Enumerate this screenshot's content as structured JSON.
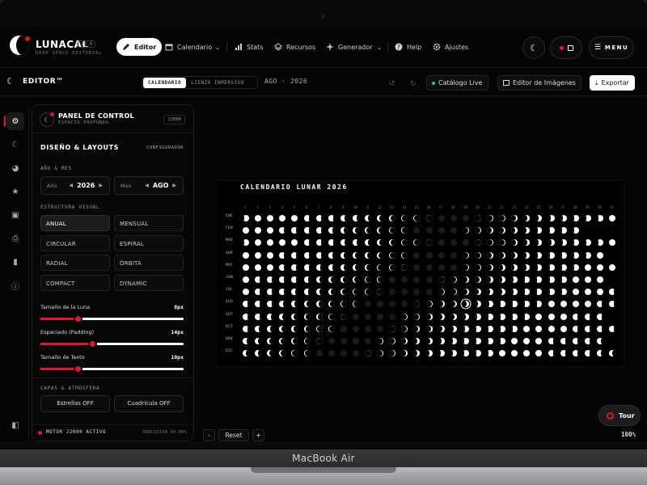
{
  "device": {
    "label": "MacBook Air"
  },
  "app": {
    "name": "LUNACAL",
    "version": "v2.6",
    "tagline": "DEEP SPACE EDITORIAL"
  },
  "nav": {
    "items": [
      {
        "label": "Editor",
        "icon": "pen-icon",
        "active": true
      },
      {
        "label": "Calendario",
        "icon": "calendar-icon",
        "active": false
      },
      {
        "label": "Stats",
        "icon": "bar-chart-icon",
        "active": false
      },
      {
        "label": "Recursos",
        "icon": "layers-icon",
        "active": false
      },
      {
        "label": "Generador",
        "icon": "sparkle-icon",
        "active": false
      },
      {
        "label": "Help",
        "icon": "help-icon",
        "active": false
      },
      {
        "label": "Ajustes",
        "icon": "gear-icon",
        "active": false
      }
    ],
    "menu_label": "MENU"
  },
  "toolbar": {
    "title": "EDITOR™",
    "views": [
      {
        "label": "CALENDARIO",
        "active": true
      },
      {
        "label": "LIENZO INMERSIVO",
        "active": false
      }
    ],
    "month": "AGO · 2026",
    "catalog_label": "Catálogo Live",
    "image_editor_label": "Editor de Imágenes",
    "export_label": "Exportar"
  },
  "panel": {
    "title": "PANEL DE CONTROL",
    "subtitle": "ESPACIO PROFUNDO",
    "tag": "J2000",
    "section_title": "DISEÑO & LAYOUTS",
    "section_link": "CONFIGURADOR",
    "year_month_label": "AÑO & MES",
    "year": {
      "label": "Año",
      "value": "2026"
    },
    "month": {
      "label": "Mes",
      "value": "AGO"
    },
    "structure_label": "ESTRUCTURA VISUAL",
    "layouts": [
      {
        "label": "ANUAL",
        "active": true
      },
      {
        "label": "MENSUAL",
        "active": false
      },
      {
        "label": "CIRCULAR",
        "active": false
      },
      {
        "label": "ESPIRAL",
        "active": false
      },
      {
        "label": "RADIAL",
        "active": false
      },
      {
        "label": "ÓRBITA",
        "active": false
      },
      {
        "label": "COMPACT",
        "active": false
      },
      {
        "label": "DYNAMIC",
        "active": false
      }
    ],
    "sliders": [
      {
        "label": "Tamaño de la Luna",
        "value": "8px",
        "fraction": 0.26
      },
      {
        "label": "Espaciado (Padding)",
        "value": "14px",
        "fraction": 0.36
      },
      {
        "label": "Tamaño de Texto",
        "value": "10px",
        "fraction": 0.26
      }
    ],
    "layers_label": "CAPAS & ATMÓSFERA",
    "toggles": [
      {
        "label": "Estrellas OFF"
      },
      {
        "label": "Cuadrícula OFF"
      }
    ],
    "footer_status": "MOTOR J2000 ACTIVO",
    "footer_precision": "PRECISIÓN 99.98%"
  },
  "calendar": {
    "title": "CALENDARIO LUNAR 2026",
    "months": [
      "ENE",
      "FEB",
      "MAR",
      "ABR",
      "MAY",
      "JUN",
      "JUL",
      "AGO",
      "SEP",
      "OCT",
      "NOV",
      "DIC"
    ],
    "days_in_month": [
      31,
      28,
      31,
      30,
      31,
      30,
      31,
      31,
      30,
      31,
      30,
      31
    ],
    "days": [
      "1",
      "2",
      "3",
      "4",
      "5",
      "6",
      "7",
      "8",
      "9",
      "10",
      "11",
      "12",
      "13",
      "14",
      "15",
      "16",
      "17",
      "18",
      "19",
      "20",
      "21",
      "22",
      "23",
      "24",
      "25",
      "26",
      "27",
      "28",
      "29",
      "30",
      "31"
    ],
    "highlight": {
      "month": "AGO",
      "day": 19
    }
  },
  "canvas_controls": {
    "minus": "-",
    "reset": "Reset",
    "plus": "+",
    "zoom": "100%"
  },
  "tour": {
    "label": "Tour"
  },
  "colors": {
    "accent": "#e0182f",
    "background": "#050505",
    "live": "#2ecc71"
  }
}
